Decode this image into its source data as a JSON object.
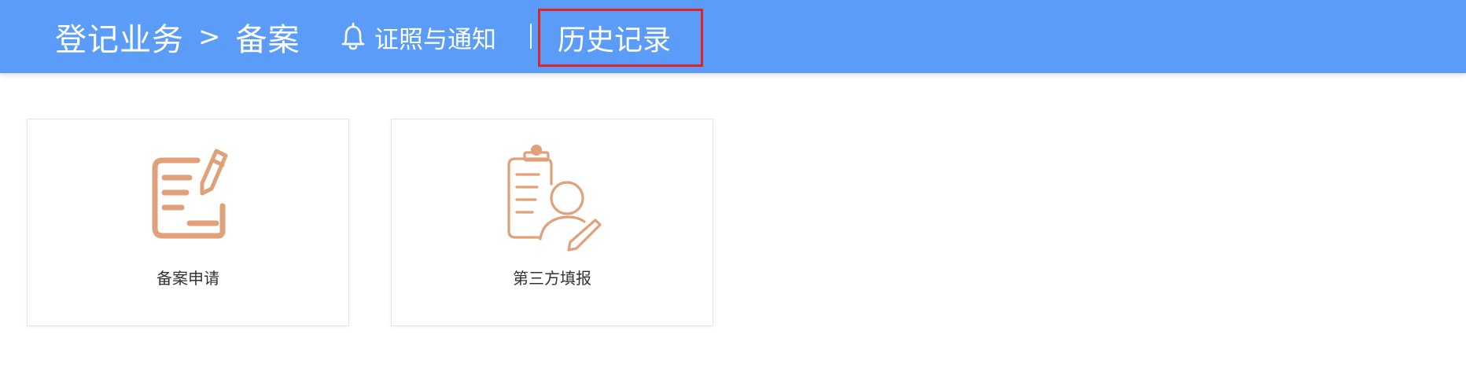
{
  "header": {
    "breadcrumb": {
      "root": "登记业务",
      "separator": ">",
      "current": "备案"
    },
    "notice_label": "证照与通知",
    "divider": "|",
    "history_label": "历史记录"
  },
  "cards": [
    {
      "label": "备案申请",
      "icon": "edit-document-icon"
    },
    {
      "label": "第三方填报",
      "icon": "clipboard-person-icon"
    }
  ],
  "colors": {
    "header_bg": "#5b9cf8",
    "icon_color": "#e0a07a",
    "highlight_border": "#e0252a"
  }
}
